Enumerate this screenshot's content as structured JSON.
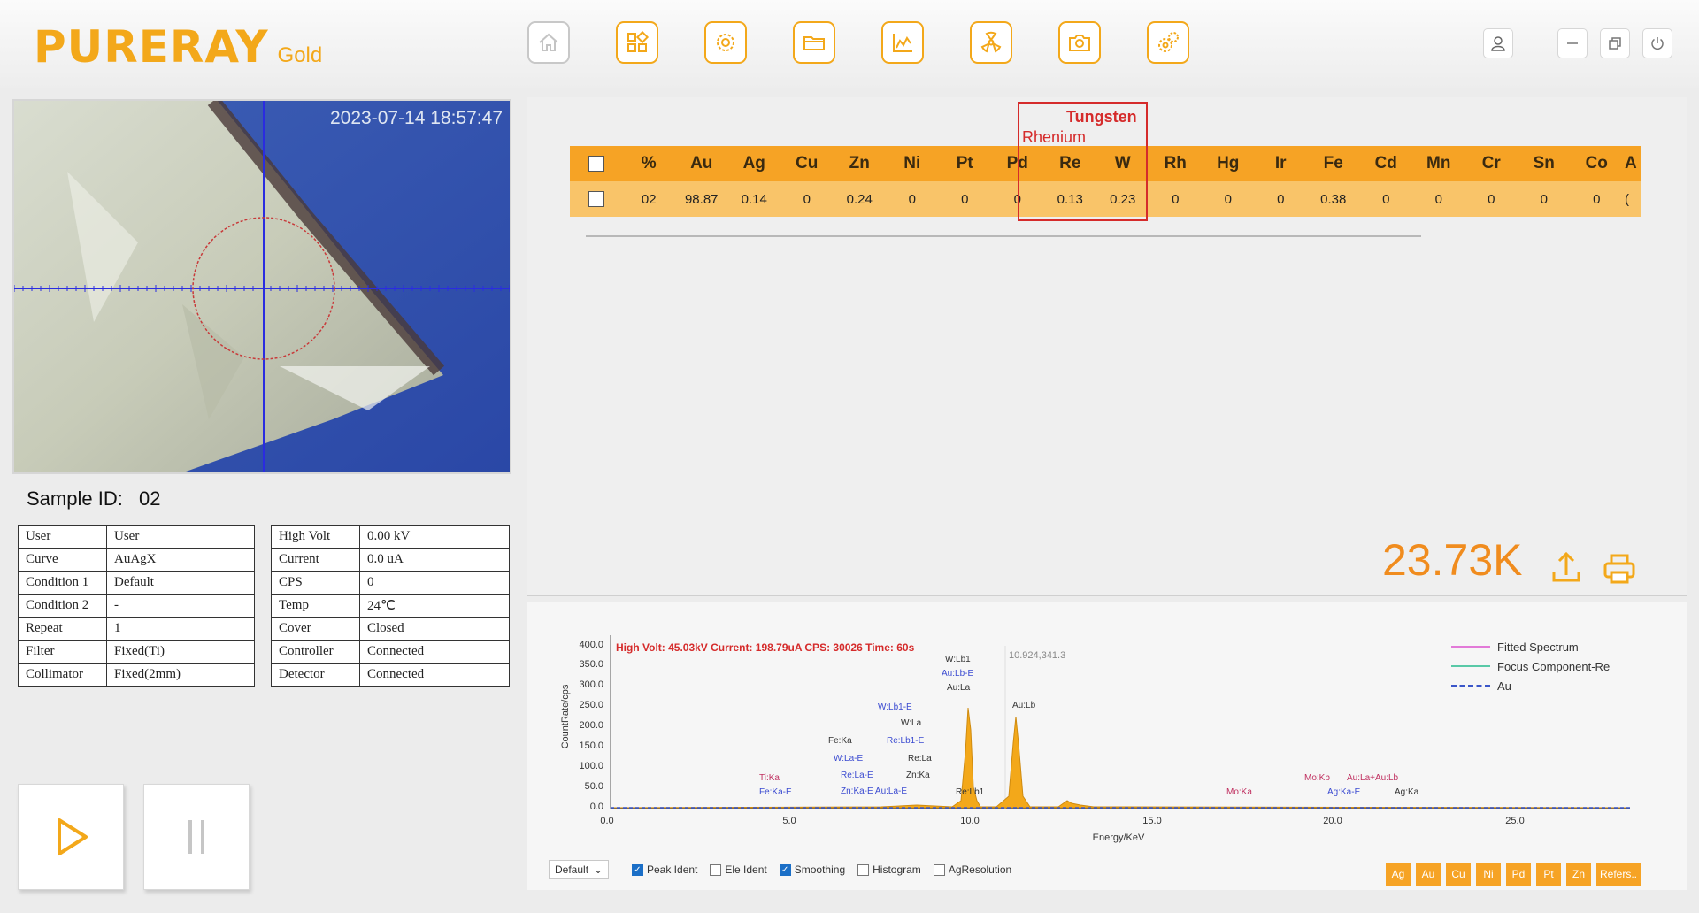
{
  "app": {
    "logo": "PURERAY",
    "edition": "Gold"
  },
  "toolbar": {
    "items": [
      {
        "name": "home-icon"
      },
      {
        "name": "grid-icon"
      },
      {
        "name": "settings-icon"
      },
      {
        "name": "folder-icon"
      },
      {
        "name": "chart-icon"
      },
      {
        "name": "radiation-icon"
      },
      {
        "name": "camera-icon"
      },
      {
        "name": "gears-icon"
      }
    ]
  },
  "camera": {
    "timestamp": "2023-07-14 18:57:47"
  },
  "sample": {
    "label": "Sample ID:",
    "id": "02"
  },
  "info_left": [
    [
      "User",
      "User"
    ],
    [
      "Curve",
      "AuAgX"
    ],
    [
      "Condition 1",
      "Default"
    ],
    [
      "Condition 2",
      "-"
    ],
    [
      "Repeat",
      "1"
    ],
    [
      "Filter",
      "Fixed(Ti)"
    ],
    [
      "Collimator",
      "Fixed(2mm)"
    ]
  ],
  "info_right": [
    [
      "High Volt",
      "0.00 kV"
    ],
    [
      "Current",
      "0.0 uA"
    ],
    [
      "CPS",
      "0"
    ],
    [
      "Temp",
      "24℃"
    ],
    [
      "Cover",
      "Closed"
    ],
    [
      "Controller",
      "Connected"
    ],
    [
      "Detector",
      "Connected"
    ]
  ],
  "results": {
    "headers": [
      "%",
      "Au",
      "Ag",
      "Cu",
      "Zn",
      "Ni",
      "Pt",
      "Pd",
      "Re",
      "W",
      "Rh",
      "Hg",
      "Ir",
      "Fe",
      "Cd",
      "Mn",
      "Cr",
      "Sn",
      "Co",
      "A"
    ],
    "row": [
      "02",
      "98.87",
      "0.14",
      "0",
      "0.24",
      "0",
      "0",
      "0",
      "0.13",
      "0.23",
      "0",
      "0",
      "0",
      "0.38",
      "0",
      "0",
      "0",
      "0",
      "0",
      "("
    ]
  },
  "annotation": {
    "line1": "Tungsten",
    "line2": "Rhenium"
  },
  "count": "23.73K",
  "spectrum": {
    "info": "High Volt: 45.03kV   Current: 198.79uA   CPS: 30026   Time: 60s",
    "cursor": "10.924,341.3",
    "ylabel": "CountRate/cps",
    "xlabel": "Energy/KeV",
    "yticks": [
      "400.0",
      "350.0",
      "300.0",
      "250.0",
      "200.0",
      "150.0",
      "100.0",
      "50.0",
      "0.0"
    ],
    "xticks": [
      "0.0",
      "5.0",
      "10.0",
      "15.0",
      "20.0",
      "25.0"
    ],
    "legend": [
      {
        "label": "Fitted Spectrum",
        "color": "#e27ad8"
      },
      {
        "label": "Focus Component-Re",
        "color": "#59c9a7"
      },
      {
        "label": "Au",
        "color": "#3a56c9"
      }
    ],
    "peak_labels": {
      "wlb1": "W:Lb1",
      "aulbe": "Au:Lb-E",
      "aula": "Au:La",
      "aulb": "Au:Lb",
      "wlb1e": "W:Lb1-E",
      "wla": "W:La",
      "felka": "Fe:Ka",
      "relb1e": "Re:Lb1-E",
      "wlae": "W:La-E",
      "rela": "Re:La",
      "relae": "Re:La-E",
      "znka": "Zn:Ka",
      "tika": "Ti:Ka",
      "fekae": "Fe:Ka-E",
      "znkae": "Zn:Ka-E Au:La-E",
      "relb1": "Re:Lb1",
      "moka": "Mo:Ka",
      "mokb": "Mo:Kb",
      "aulaaulb": "Au:La+Au:Lb",
      "agkae": "Ag:Ka-E",
      "agka": "Ag:Ka"
    }
  },
  "bottom": {
    "preset": "Default",
    "checks": [
      {
        "label": "Peak Ident",
        "checked": true
      },
      {
        "label": "Ele Ident",
        "checked": false
      },
      {
        "label": "Smoothing",
        "checked": true
      },
      {
        "label": "Histogram",
        "checked": false
      },
      {
        "label": "AgResolution",
        "checked": false
      }
    ],
    "elements": [
      "Ag",
      "Au",
      "Cu",
      "Ni",
      "Pd",
      "Pt",
      "Zn",
      "Refers.."
    ]
  },
  "colors": {
    "accent": "#f3a81a",
    "header_row": "#f6a325",
    "data_row": "#f9c469",
    "annotation": "#d52b2b",
    "count": "#f08c1e"
  }
}
